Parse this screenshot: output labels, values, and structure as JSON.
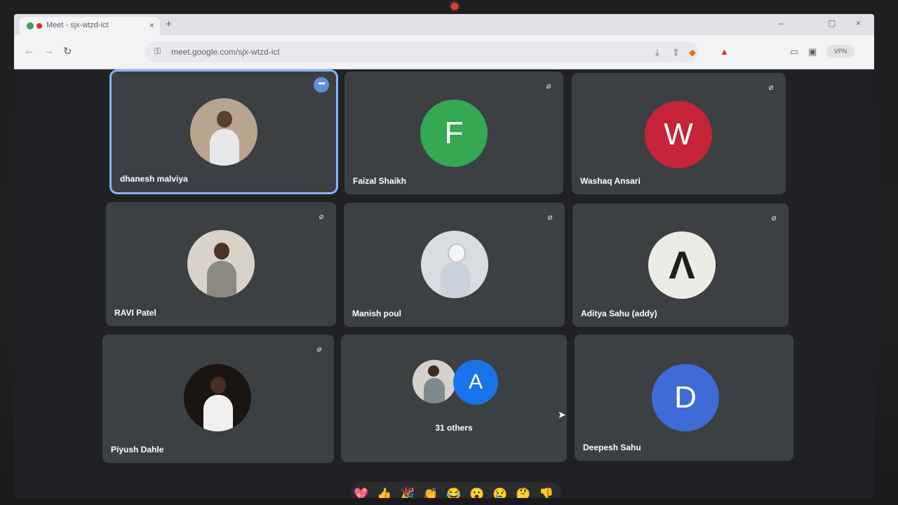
{
  "browser": {
    "tab_title": "Meet - sjx-wtzd-ict",
    "tab_close": "×",
    "new_tab": "+",
    "url": "meet.google.com/sjx-wtzd-ict",
    "profile_label": "VPN",
    "window_controls": [
      "–",
      "▢",
      "×"
    ]
  },
  "colors": {
    "active_border": "#8ab4f8",
    "tile_bg": "#3c4043",
    "stage_bg": "#202124",
    "avatar_faizal": "#34a853",
    "avatar_washaq": "#c5243a",
    "avatar_a": "#1a73e8",
    "avatar_deepesh": "#3f6bd6"
  },
  "participants": [
    {
      "name": "dhanesh malviya",
      "muted": false,
      "active": true,
      "avatar_type": "photo"
    },
    {
      "name": "Faizal Shaikh",
      "muted": true,
      "avatar_type": "letter",
      "letter": "F"
    },
    {
      "name": "Washaq Ansari",
      "muted": true,
      "avatar_type": "letter",
      "letter": "W"
    },
    {
      "name": "RAVI Patel",
      "muted": true,
      "avatar_type": "photo"
    },
    {
      "name": "Manish poul",
      "muted": true,
      "avatar_type": "photo"
    },
    {
      "name": "Aditya Sahu (addy)",
      "muted": true,
      "avatar_type": "logo"
    },
    {
      "name": "Piyush Dahle",
      "muted": true,
      "avatar_type": "photo"
    },
    {
      "name": "Deepesh Sahu",
      "muted": false,
      "avatar_type": "letter",
      "letter": "D"
    }
  ],
  "others": {
    "label": "31 others",
    "letter": "A"
  },
  "icons": {
    "mic_off": "mic-off-icon",
    "more": "more-options-icon"
  },
  "reactions": [
    "💖",
    "👍",
    "🎉",
    "👏",
    "😂",
    "😮",
    "😢",
    "🤔",
    "👎"
  ]
}
